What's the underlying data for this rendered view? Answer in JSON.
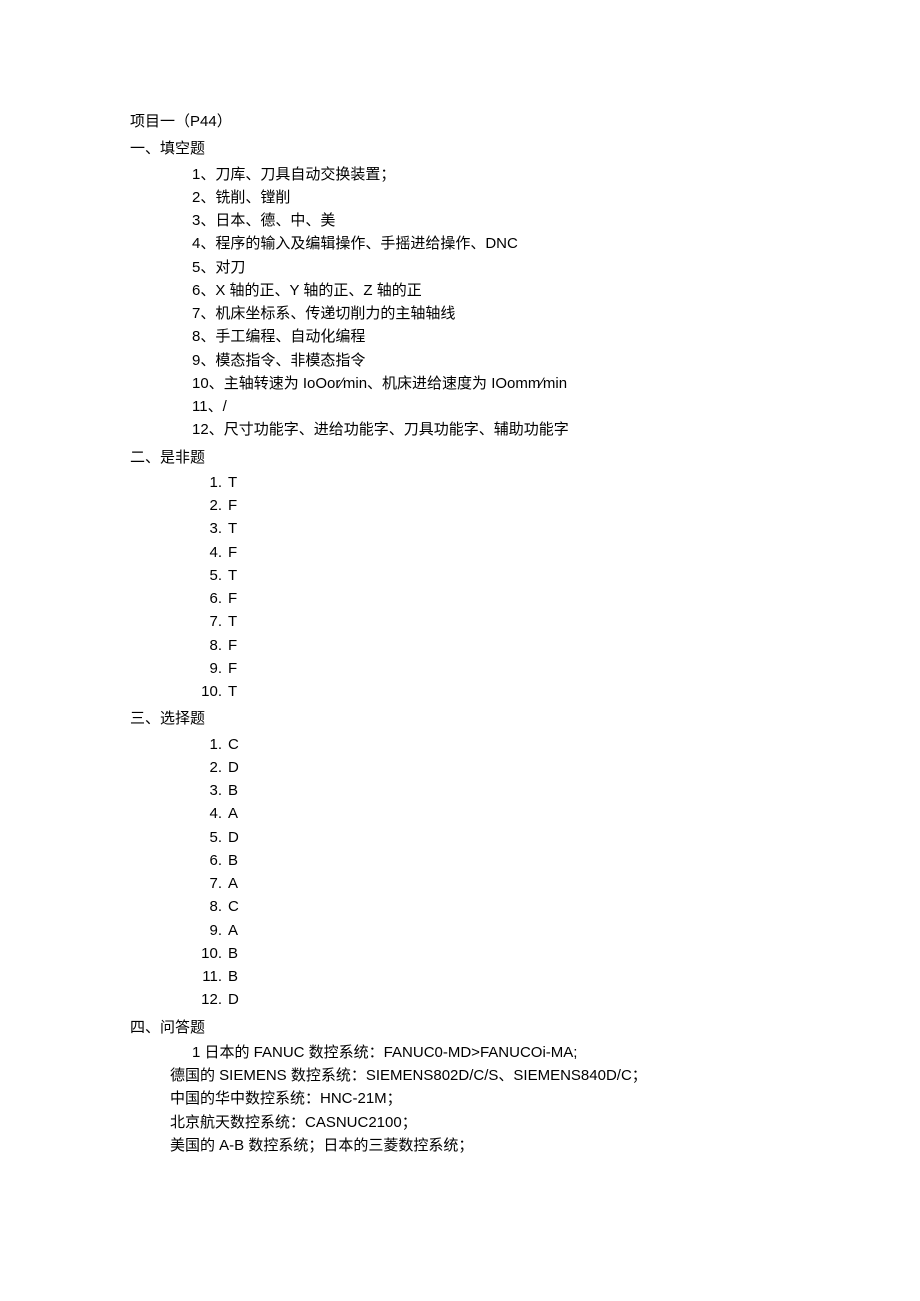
{
  "project_heading": "项目一（P44）",
  "sections": {
    "fill": {
      "title": "一、填空题",
      "items": [
        "刀库、刀具自动交换装置；",
        "铣削、镗削",
        "日本、德、中、美",
        "程序的输入及编辑操作、手摇进给操作、DNC",
        "对刀",
        "X 轴的正、Y 轴的正、Z 轴的正",
        "机床坐标系、传递切削力的主轴轴线",
        "手工编程、自动化编程",
        "模态指令、非模态指令",
        "主轴转速为 IoOor∕min、机床进给速度为 IOomm∕min",
        "/",
        "尺寸功能字、进给功能字、刀具功能字、辅助功能字"
      ]
    },
    "truefalse": {
      "title": "二、是非题",
      "answers": [
        "T",
        "F",
        "T",
        "F",
        "T",
        "F",
        "T",
        "F",
        "F",
        "T"
      ]
    },
    "choice": {
      "title": "三、选择题",
      "answers": [
        "C",
        "D",
        "B",
        "A",
        "D",
        "B",
        "A",
        "C",
        "A",
        "B",
        "B",
        "D"
      ]
    },
    "qa": {
      "title": "四、问答题",
      "lines": [
        "1 日本的 FANUC 数控系统：FANUC0-MD>FANUCOi-MA;",
        "德国的 SIEMENS 数控系统：SIEMENS802D/C/S、SIEMENS840D/C；",
        "中国的华中数控系统：HNC-21M；",
        "北京航天数控系统：CASNUC2100；",
        "美国的 A-B 数控系统；日本的三菱数控系统；"
      ]
    }
  }
}
